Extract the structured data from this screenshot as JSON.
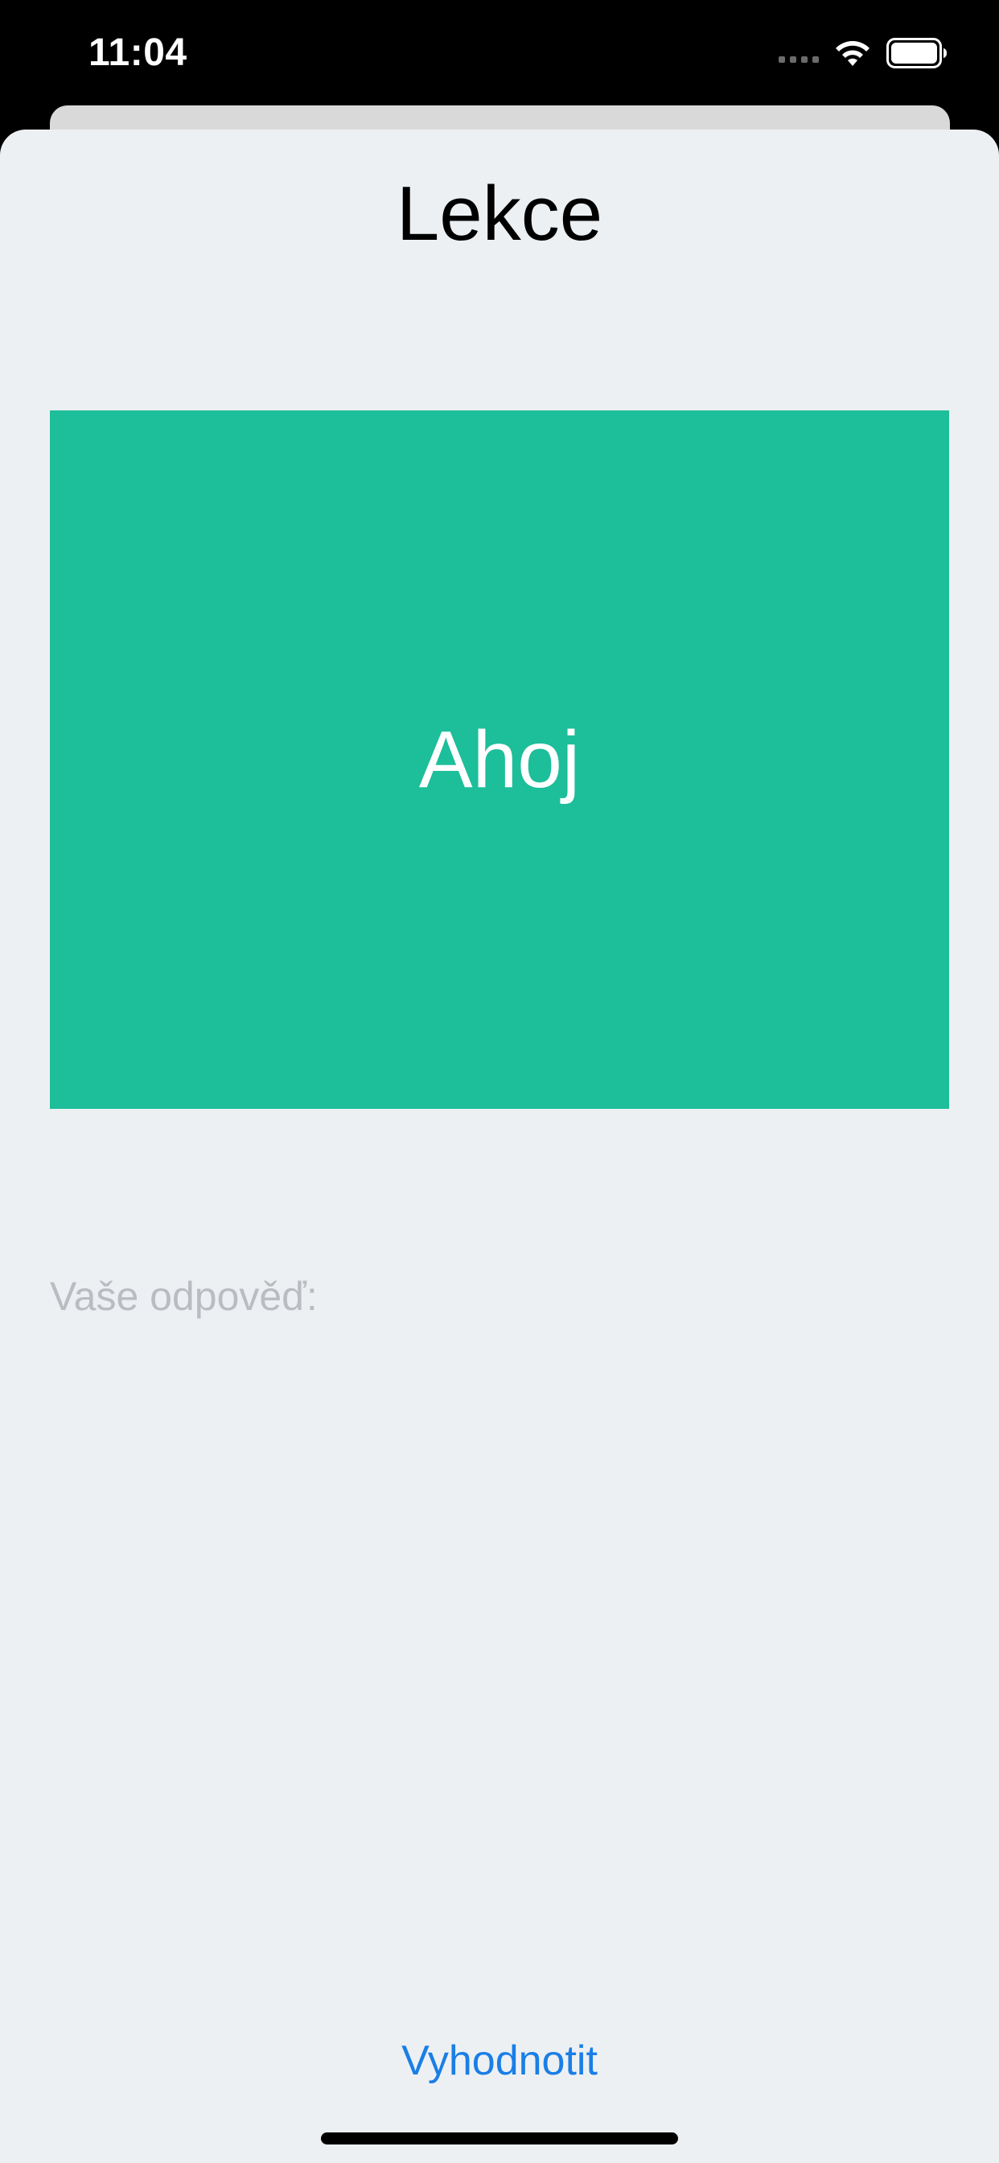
{
  "status_bar": {
    "time": "11:04",
    "icons": [
      "cellular-signal-icon",
      "wifi-icon",
      "battery-icon"
    ]
  },
  "sheet": {
    "title": "Lekce",
    "card": {
      "word": "Ahoj",
      "color": "#1dbe9a"
    },
    "answer": {
      "placeholder": "Vaše odpověď:",
      "value": ""
    },
    "evaluate_label": "Vyhodnotit"
  },
  "colors": {
    "background": "#edf0f2",
    "accent": "#1a7ee6",
    "placeholder": "#b9bdc2"
  }
}
